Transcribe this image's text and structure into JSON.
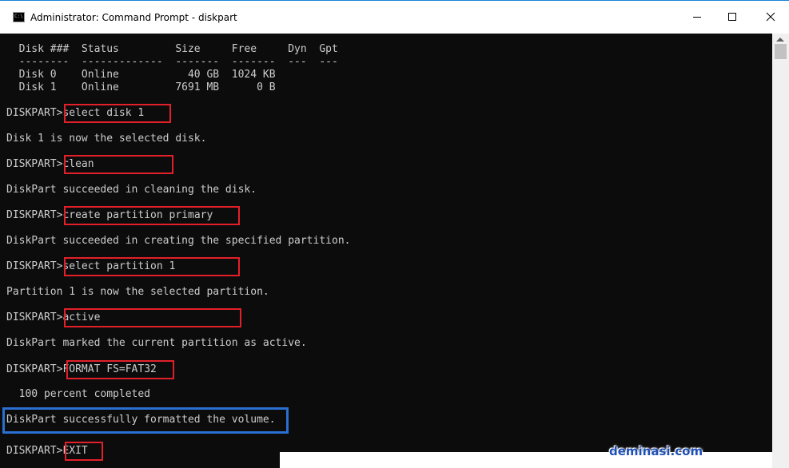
{
  "window": {
    "title": "Administrator: Command Prompt - diskpart",
    "icon": "cmd-icon",
    "controls": {
      "minimize": "minimize-icon",
      "maximize": "maximize-icon",
      "close": "close-icon"
    }
  },
  "colors": {
    "console_bg": "#0c0c0c",
    "console_text": "#cccccc",
    "highlight_red": "#e3202a",
    "highlight_blue": "#2a6fd1",
    "watermark": "#1e4fb5"
  },
  "disk_table": {
    "header": "  Disk ###  Status         Size     Free     Dyn  Gpt",
    "separator": "  --------  -------------  -------  -------  ---  ---",
    "rows": [
      "  Disk 0    Online           40 GB  1024 KB",
      "  Disk 1    Online         7691 MB      0 B"
    ]
  },
  "prompt": "DISKPART>",
  "steps": [
    {
      "command": "select disk 1",
      "response": "Disk 1 is now the selected disk."
    },
    {
      "command": "clean",
      "response": "DiskPart succeeded in cleaning the disk."
    },
    {
      "command": "create partition primary",
      "response": "DiskPart succeeded in creating the specified partition."
    },
    {
      "command": "select partition 1",
      "response": "Partition 1 is now the selected partition."
    },
    {
      "command": "active",
      "response": "DiskPart marked the current partition as active."
    },
    {
      "command": "FORMAT FS=FAT32",
      "response": "  100 percent completed"
    }
  ],
  "success_message": "DiskPart successfully formatted the volume.",
  "final_command": "EXIT",
  "watermark": "deminasi.com"
}
